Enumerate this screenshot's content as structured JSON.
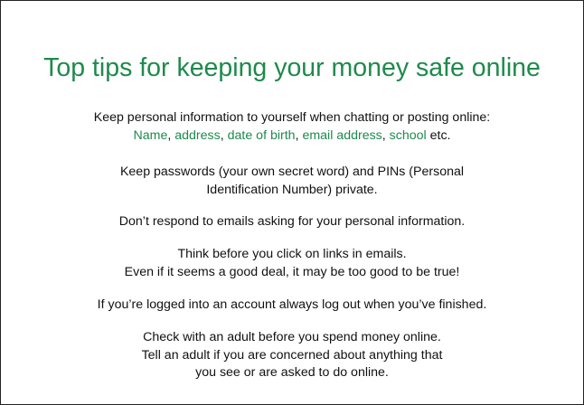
{
  "title": "Top tips for keeping your money safe online",
  "colors": {
    "accent": "#1e8a4c",
    "text": "#111111",
    "border": "#222222"
  },
  "tips": {
    "personal_info": {
      "line1": "Keep personal information to yourself when chatting or posting online:",
      "examples": [
        "Name",
        "address",
        "date of birth",
        "email address",
        "school"
      ],
      "separator": ", ",
      "suffix": " etc."
    },
    "passwords": {
      "line1": "Keep passwords (your own secret word) and PINs (Personal",
      "line2": "Identification Number) private."
    },
    "emails": {
      "line1": "Don’t respond to emails asking for your personal information."
    },
    "links": {
      "line1": "Think before you click on links in emails.",
      "line2": "Even if it seems a good deal, it may be too good to be true!"
    },
    "logout": {
      "line1": "If you’re logged into an account always log out when you’ve finished."
    },
    "adult": {
      "line1": "Check with an adult before you spend money online.",
      "line2": "Tell an adult if you are concerned about anything that",
      "line3": "you see or are asked to do online."
    }
  }
}
